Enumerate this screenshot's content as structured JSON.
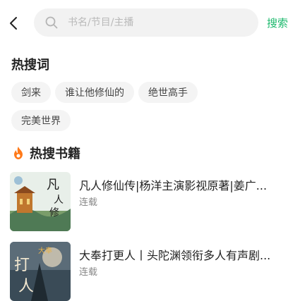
{
  "search": {
    "placeholder": "书名/节目/主播",
    "button_label": "搜索"
  },
  "hot_words": {
    "title": "热搜词",
    "items": [
      "剑来",
      "谁让他修仙的",
      "绝世高手",
      "完美世界"
    ]
  },
  "hot_books": {
    "title": "热搜书籍",
    "items": [
      {
        "title": "凡人修仙传|杨洋主演影视原著|姜广...",
        "status": "连载"
      },
      {
        "title": "大奉打更人丨头陀渊领衔多人有声剧...",
        "status": "连载"
      }
    ]
  },
  "colors": {
    "accent": "#1ab86b",
    "fire": "#ff7a1a"
  }
}
